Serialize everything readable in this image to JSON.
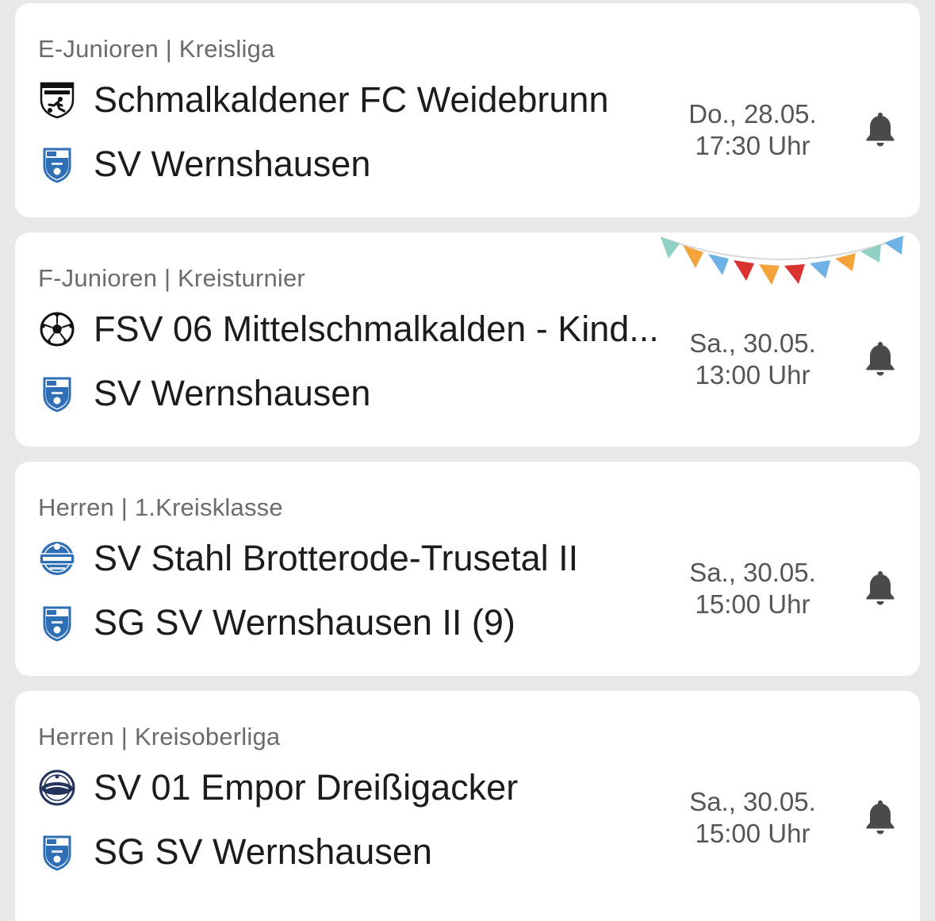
{
  "colors": {
    "background": "#e8e8e8",
    "card": "#ffffff",
    "crest_blue": "#2f6fb5",
    "bell": "#4a4a4a"
  },
  "matches": [
    {
      "competition": "E-Junioren | Kreisliga",
      "home": {
        "name": "Schmalkaldener FC Weidebrunn",
        "logo": "sfc-weidebrunn-crest-icon"
      },
      "away": {
        "name": "SV Wernshausen",
        "logo": "sv-wernshausen-crest-icon"
      },
      "date": "Do., 28.05.",
      "time": "17:30 Uhr",
      "notification_icon": "bell-icon"
    },
    {
      "competition": "F-Junioren | Kreisturnier",
      "home": {
        "name": "FSV 06 Mittelschmalkalden - Kind...",
        "logo": "soccer-ball-icon"
      },
      "away": {
        "name": "SV Wernshausen",
        "logo": "sv-wernshausen-crest-icon"
      },
      "date": "Sa., 30.05.",
      "time": "13:00 Uhr",
      "notification_icon": "bell-icon",
      "decoration": "bunting-garland"
    },
    {
      "competition": "Herren | 1.Kreisklasse",
      "home": {
        "name": "SV Stahl Brotterode-Trusetal II",
        "logo": "sv-stahl-brotterode-crest-icon"
      },
      "away": {
        "name": "SG SV Wernshausen II (9)",
        "logo": "sv-wernshausen-crest-icon"
      },
      "date": "Sa., 30.05.",
      "time": "15:00 Uhr",
      "notification_icon": "bell-icon"
    },
    {
      "competition": "Herren | Kreisoberliga",
      "home": {
        "name": "SV 01 Empor Dreißigacker",
        "logo": "empor-dreissigacker-crest-icon"
      },
      "away": {
        "name": "SG SV Wernshausen",
        "logo": "sv-wernshausen-crest-icon"
      },
      "date": "Sa., 30.05.",
      "time": "15:00 Uhr",
      "notification_icon": "bell-icon"
    }
  ]
}
